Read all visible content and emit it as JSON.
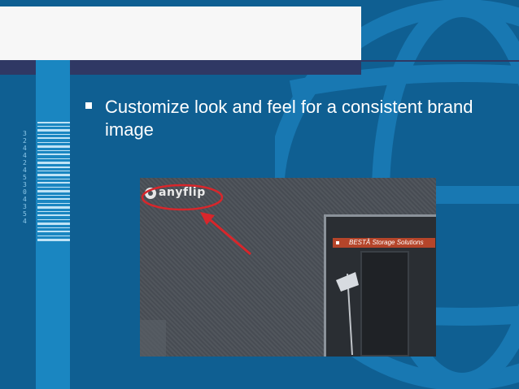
{
  "slide": {
    "bullet_text": "Customize look and feel for a consistent brand image",
    "barcode_digits": "3\n2\n4\n4\n2\n4\n5\n3\n0\n4\n3\n5\n4"
  },
  "screenshot": {
    "logo_text": "anyflip",
    "preview_title": "BESTÅ Storage Solutions"
  },
  "colors": {
    "background": "#0f5f92",
    "left_strip": "#1a86c1",
    "dark_bar": "#2f3864",
    "highlight_red": "#d8262b"
  }
}
